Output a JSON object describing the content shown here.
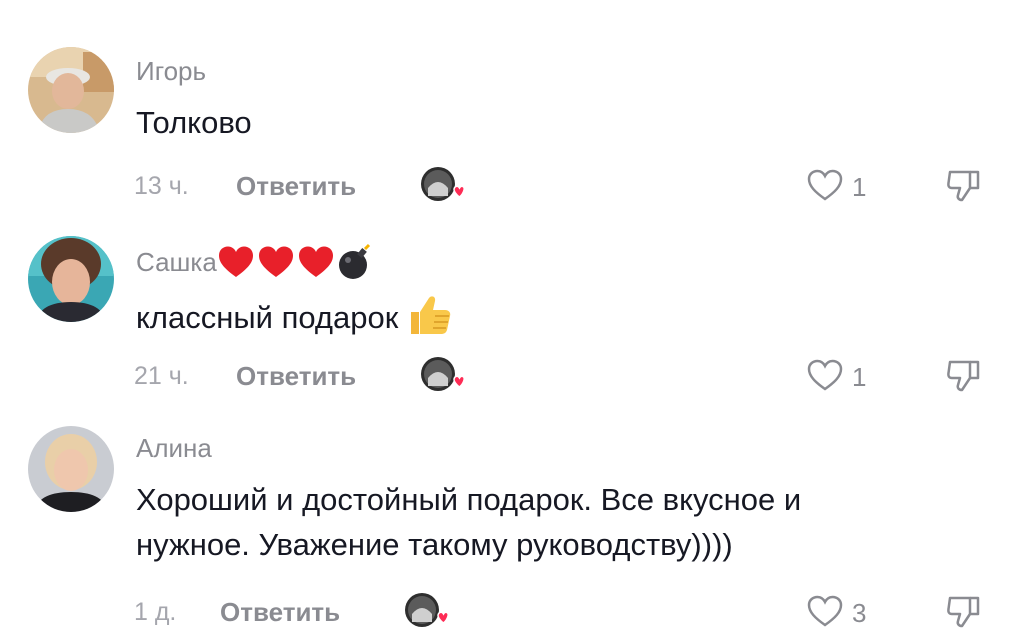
{
  "comments": [
    {
      "author": "Игорь",
      "text": "Толково",
      "time": "13 ч.",
      "reply_label": "Ответить",
      "likes": "1",
      "avatar_icon": "user-photo-igor",
      "liked_by_creator": true
    },
    {
      "author": "Сашка",
      "author_emojis": [
        "heart-emoji",
        "heart-emoji",
        "heart-emoji",
        "bomb-emoji"
      ],
      "text": "классный подарок",
      "text_emoji": "thumbs-up-emoji",
      "time": "21 ч.",
      "reply_label": "Ответить",
      "likes": "1",
      "avatar_icon": "user-photo-sashka",
      "liked_by_creator": true
    },
    {
      "author": "Алина",
      "text_lines": [
        "Хороший и достойный подарок. Все вкусное и",
        "нужное. Уважение такому руководству))))"
      ],
      "time": "1 д.",
      "reply_label": "Ответить",
      "likes": "3",
      "avatar_icon": "user-photo-alina",
      "liked_by_creator": true
    }
  ],
  "colors": {
    "text": "#161823",
    "muted": "#8a8b91",
    "heart_red": "#fe2c55",
    "emoji_heart": "#e8202a"
  }
}
